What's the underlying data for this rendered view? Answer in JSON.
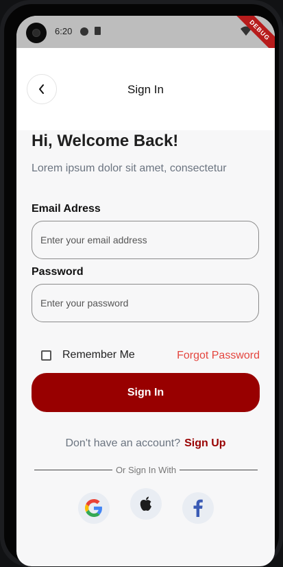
{
  "status_bar": {
    "time": "6:20",
    "debug_label": "DEBUG"
  },
  "header": {
    "title": "Sign In"
  },
  "welcome": {
    "title": "Hi, Welcome Back!",
    "subtitle": "Lorem ipsum dolor sit amet, consectetur"
  },
  "form": {
    "email_label": "Email Adress",
    "email_placeholder": "Enter your email address",
    "email_value": "",
    "password_label": "Password",
    "password_placeholder": "Enter your password",
    "password_value": "",
    "remember_label": "Remember Me",
    "remember_checked": false,
    "forgot_label": "Forgot Password",
    "submit_label": "Sign In"
  },
  "signup": {
    "prompt": "Don't have an account?",
    "link": "Sign Up"
  },
  "social": {
    "divider_text": "Or Sign In With",
    "providers": [
      "google-icon",
      "apple-icon",
      "facebook-icon"
    ]
  },
  "colors": {
    "primary": "#980000",
    "link_red": "#e4453e",
    "muted_text": "#6b7480",
    "social_bg": "#e9edf3",
    "facebook_blue": "#3b5bb5"
  }
}
